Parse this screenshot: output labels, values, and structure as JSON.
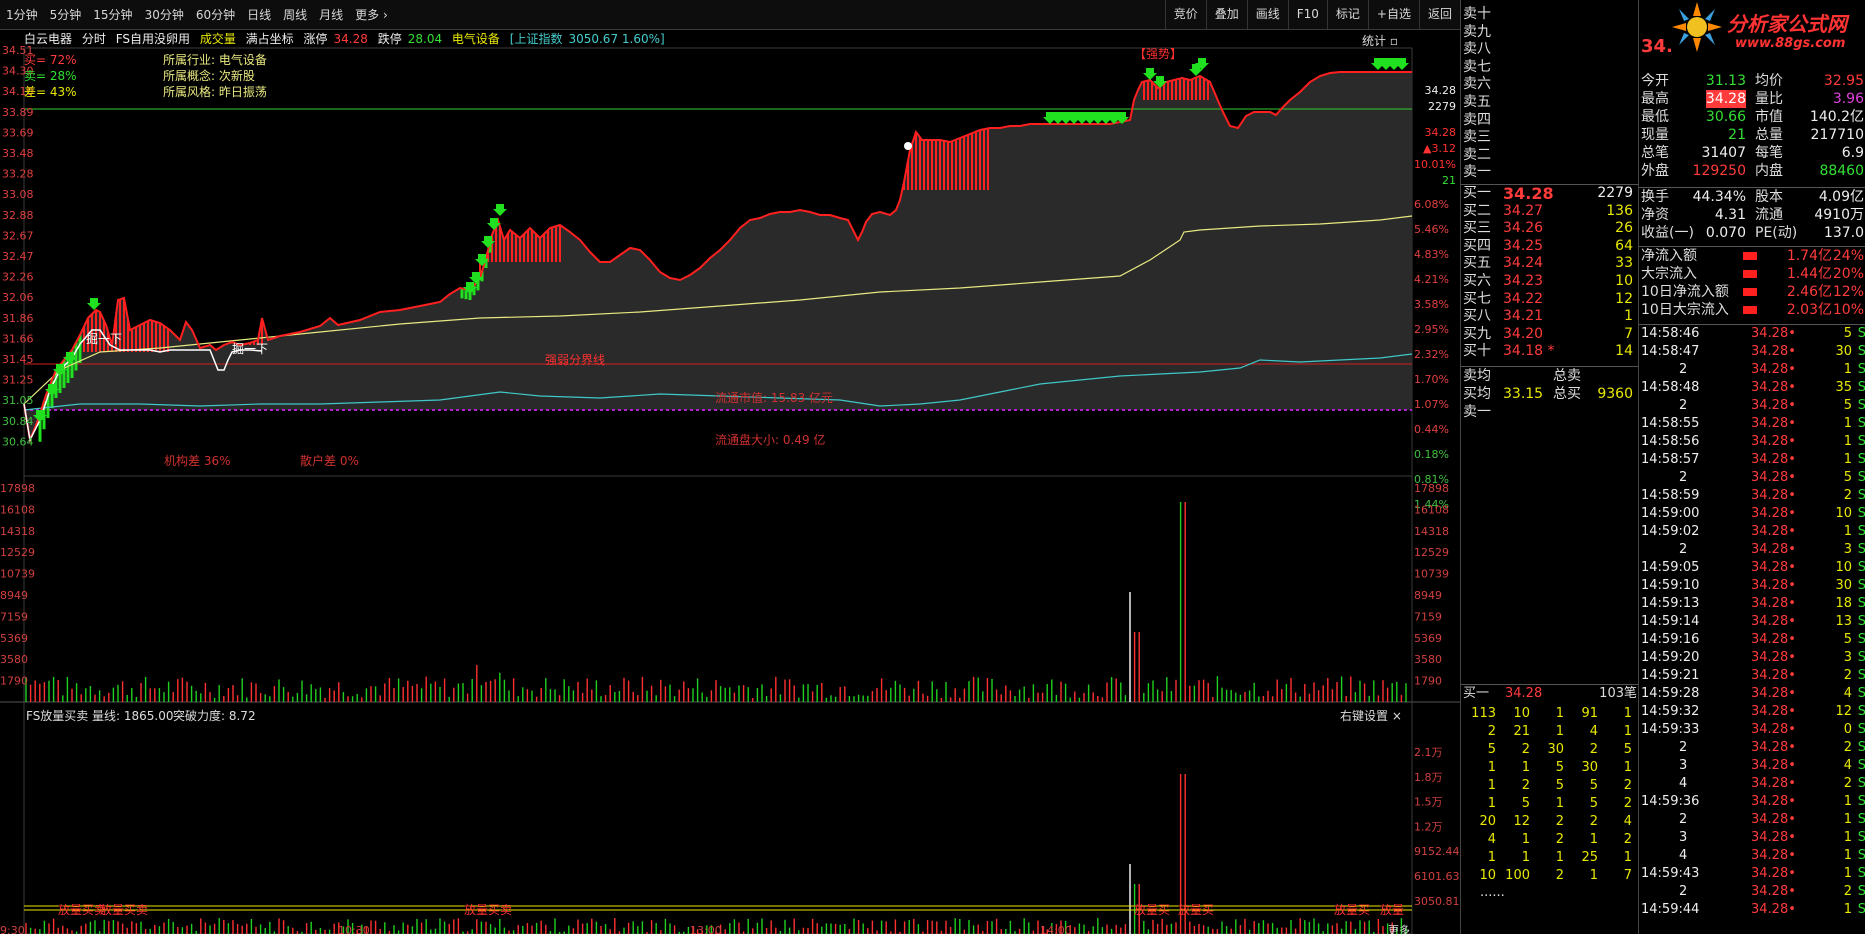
{
  "colors": {
    "up": "#ff3b3b",
    "down": "#33e033",
    "avg": "#e8e800",
    "volume_up": "#ff3b3b",
    "volume_down": "#33e033",
    "band": "#e8e800",
    "cyan": "#44cccc"
  },
  "toolbar": {
    "periods": [
      "1分钟",
      "5分钟",
      "15分钟",
      "30分钟",
      "60分钟",
      "日线",
      "周线",
      "月线",
      "更多"
    ],
    "tools": [
      "竞价",
      "叠加",
      "画线",
      "F10",
      "标记",
      "+自选",
      "返回"
    ]
  },
  "stock": {
    "name": "白云电器",
    "mode": "分时",
    "indicator": "FS自用没卵用",
    "vol_label": "成交量",
    "coord_label": "满占坐标",
    "limit_up_label": "涨停",
    "limit_up": "34.28",
    "limit_down_label": "跌停",
    "limit_down": "28.04",
    "sector": "电气设备",
    "index_name": "[上证指数",
    "index_val": "3050.67 1.60%]",
    "stats_label": "统计"
  },
  "legend": {
    "buy": "买= 72%",
    "sell": "卖= 28%",
    "diff": "差= 43%",
    "industry": "所属行业: 电气设备",
    "concept": "所属概念: 次新股",
    "style": "所属风格: 昨日振荡"
  },
  "chart_labels": {
    "strength_line": "强弱分界线",
    "float_cap": "流通市值: 15.83 亿元",
    "float_size": "流通盘大小: 0.49 亿",
    "inst_diff": "机构差  36%",
    "retail_diff": "散户差  0%",
    "strong": "【强势】",
    "dig1": "掘一下",
    "dig2": "掘一下"
  },
  "price_axis_left": [
    "34.51",
    "34.30",
    "34.10",
    "33.89",
    "33.69",
    "33.48",
    "33.28",
    "33.08",
    "32.88",
    "32.67",
    "32.47",
    "32.26",
    "32.06",
    "31.86",
    "31.66",
    "31.45",
    "31.25",
    "31.05",
    "30.84",
    "30.64"
  ],
  "pct_axis_right": [
    "6.08%",
    "5.46%",
    "4.83%",
    "4.21%",
    "3.58%",
    "2.95%",
    "2.32%",
    "1.70%",
    "1.07%",
    "0.44%",
    "0.18%",
    "0.81%",
    "1.44%"
  ],
  "right_price_top": [
    "34.28",
    "2279",
    "",
    "34.28",
    "▲3.12",
    "10.01%",
    "21"
  ],
  "vol_axis_left": [
    "17898",
    "16108",
    "14318",
    "12529",
    "10739",
    "8949",
    "7159",
    "5369",
    "3580",
    "1790"
  ],
  "vol_axis_right": [
    "17898",
    "16108",
    "14318",
    "12529",
    "10739",
    "8949",
    "7159",
    "5369",
    "3580",
    "1790"
  ],
  "sub_indicator": {
    "title": "FS放量买卖",
    "line_label": "量线: 1865.00",
    "power_label": "突破力度: 8.72",
    "settings": "右键设置 ×"
  },
  "sub_axis": [
    "2.1万",
    "1.8万",
    "1.5万",
    "1.2万",
    "9152.44",
    "6101.63",
    "3050.81"
  ],
  "sub_labels": [
    "放量买卖",
    "放量买卖",
    "放量买卖",
    "放量买",
    "放量买",
    "放量买",
    "放量"
  ],
  "time_axis": [
    "9:30",
    "10:30",
    "13:00",
    "14:00"
  ],
  "more_label": "更多",
  "orderbook": {
    "asks": [
      "卖十",
      "卖九",
      "卖八",
      "卖七",
      "卖六",
      "卖五",
      "卖四",
      "卖三",
      "卖二",
      "卖一"
    ],
    "bids": [
      {
        "name": "买一",
        "price": "34.28",
        "vol": "2279"
      },
      {
        "name": "买二",
        "price": "34.27",
        "vol": "136"
      },
      {
        "name": "买三",
        "price": "34.26",
        "vol": "26"
      },
      {
        "name": "买四",
        "price": "34.25",
        "vol": "64"
      },
      {
        "name": "买五",
        "price": "34.24",
        "vol": "33"
      },
      {
        "name": "买六",
        "price": "34.23",
        "vol": "10"
      },
      {
        "name": "买七",
        "price": "34.22",
        "vol": "12"
      },
      {
        "name": "买八",
        "price": "34.21",
        "vol": "1"
      },
      {
        "name": "买九",
        "price": "34.20",
        "vol": "7"
      },
      {
        "name": "买十",
        "price": "34.18 *",
        "vol": "14"
      }
    ],
    "sell_avg_label": "卖均",
    "total_sell_label": "总卖",
    "buy_avg_label": "买均",
    "buy_avg": "33.15",
    "total_buy_label": "总买",
    "total_buy": "9360",
    "sell1_label": "卖一"
  },
  "queue": {
    "header_name": "买一",
    "header_price": "34.28",
    "header_count": "103笔",
    "rows": [
      [
        "113",
        "10",
        "1",
        "91",
        "1"
      ],
      [
        "2",
        "21",
        "1",
        "4",
        "1"
      ],
      [
        "5",
        "2",
        "30",
        "2",
        "5"
      ],
      [
        "1",
        "1",
        "5",
        "30",
        "1"
      ],
      [
        "1",
        "2",
        "5",
        "5",
        "2"
      ],
      [
        "1",
        "5",
        "1",
        "5",
        "2"
      ],
      [
        "20",
        "12",
        "2",
        "2",
        "4"
      ],
      [
        "4",
        "1",
        "2",
        "1",
        "2"
      ],
      [
        "1",
        "1",
        "1",
        "25",
        "1"
      ],
      [
        "10",
        "100",
        "2",
        "1",
        "7"
      ]
    ],
    "more": "......"
  },
  "brand": {
    "name": "分析家公式网",
    "url": "www.88gs.com"
  },
  "quote": {
    "price_top": "34.",
    "rows": [
      {
        "a": "今开",
        "av": "31.13",
        "b": "均价",
        "bv": "32.95",
        "ac": "green",
        "bc": "red"
      },
      {
        "a": "最高",
        "av": "34.28",
        "b": "量比",
        "bv": "3.96",
        "ac": "redbg",
        "bc": "magenta"
      },
      {
        "a": "最低",
        "av": "30.66",
        "b": "市值",
        "bv": "140.2亿",
        "ac": "green",
        "bc": "white"
      },
      {
        "a": "现量",
        "av": "21",
        "b": "总量",
        "bv": "217710",
        "ac": "green",
        "bc": "white"
      },
      {
        "a": "总笔",
        "av": "31407",
        "b": "每笔",
        "bv": "6.9",
        "ac": "white",
        "bc": "white"
      },
      {
        "a": "外盘",
        "av": "129250",
        "b": "内盘",
        "bv": "88460",
        "ac": "red",
        "bc": "green"
      }
    ],
    "rows2": [
      {
        "a": "换手",
        "av": "44.34%",
        "b": "股本",
        "bv": "4.09亿"
      },
      {
        "a": "净资",
        "av": "4.31",
        "b": "流通",
        "bv": "4910万"
      },
      {
        "a": "收益(一)",
        "av": "0.070",
        "b": "PE(动)",
        "bv": "137.0"
      }
    ],
    "flows": [
      {
        "label": "净流入额",
        "val": "1.74亿",
        "pct": "24%"
      },
      {
        "label": "大宗流入",
        "val": "1.44亿",
        "pct": "20%"
      },
      {
        "label": "10日净流入额",
        "val": "2.46亿",
        "pct": "12%"
      },
      {
        "label": "10日大宗流入",
        "val": "2.03亿",
        "pct": "10%"
      }
    ]
  },
  "ticks": [
    {
      "t": "14:58:46",
      "p": "34.28",
      "v": "5",
      "d": "S"
    },
    {
      "t": "14:58:47",
      "p": "34.28",
      "v": "30",
      "d": "S"
    },
    {
      "t": "2",
      "p": "34.28",
      "v": "1",
      "d": "S"
    },
    {
      "t": "14:58:48",
      "p": "34.28",
      "v": "35",
      "d": "S"
    },
    {
      "t": "2",
      "p": "34.28",
      "v": "5",
      "d": "S"
    },
    {
      "t": "14:58:55",
      "p": "34.28",
      "v": "1",
      "d": "S"
    },
    {
      "t": "14:58:56",
      "p": "34.28",
      "v": "1",
      "d": "S"
    },
    {
      "t": "14:58:57",
      "p": "34.28",
      "v": "1",
      "d": "S"
    },
    {
      "t": "2",
      "p": "34.28",
      "v": "5",
      "d": "S"
    },
    {
      "t": "14:58:59",
      "p": "34.28",
      "v": "2",
      "d": "S"
    },
    {
      "t": "14:59:00",
      "p": "34.28",
      "v": "10",
      "d": "S"
    },
    {
      "t": "14:59:02",
      "p": "34.28",
      "v": "1",
      "d": "S"
    },
    {
      "t": "2",
      "p": "34.28",
      "v": "3",
      "d": "S"
    },
    {
      "t": "14:59:05",
      "p": "34.28",
      "v": "10",
      "d": "S"
    },
    {
      "t": "14:59:10",
      "p": "34.28",
      "v": "30",
      "d": "S"
    },
    {
      "t": "14:59:13",
      "p": "34.28",
      "v": "18",
      "d": "S"
    },
    {
      "t": "14:59:14",
      "p": "34.28",
      "v": "13",
      "d": "S"
    },
    {
      "t": "14:59:16",
      "p": "34.28",
      "v": "5",
      "d": "S"
    },
    {
      "t": "14:59:20",
      "p": "34.28",
      "v": "3",
      "d": "S"
    },
    {
      "t": "14:59:21",
      "p": "34.28",
      "v": "2",
      "d": "S"
    },
    {
      "t": "14:59:28",
      "p": "34.28",
      "v": "4",
      "d": "S"
    },
    {
      "t": "14:59:32",
      "p": "34.28",
      "v": "12",
      "d": "S"
    },
    {
      "t": "14:59:33",
      "p": "34.28",
      "v": "0",
      "d": "S"
    },
    {
      "t": "2",
      "p": "34.28",
      "v": "2",
      "d": "S"
    },
    {
      "t": "3",
      "p": "34.28",
      "v": "4",
      "d": "S"
    },
    {
      "t": "4",
      "p": "34.28",
      "v": "2",
      "d": "S"
    },
    {
      "t": "14:59:36",
      "p": "34.28",
      "v": "1",
      "d": "S"
    },
    {
      "t": "2",
      "p": "34.28",
      "v": "1",
      "d": "S"
    },
    {
      "t": "3",
      "p": "34.28",
      "v": "1",
      "d": "S"
    },
    {
      "t": "4",
      "p": "34.28",
      "v": "1",
      "d": "S"
    },
    {
      "t": "14:59:43",
      "p": "34.28",
      "v": "1",
      "d": "S"
    },
    {
      "t": "2",
      "p": "34.28",
      "v": "2",
      "d": "S"
    },
    {
      "t": "14:59:44",
      "p": "34.28",
      "v": "1",
      "d": "S"
    }
  ]
}
